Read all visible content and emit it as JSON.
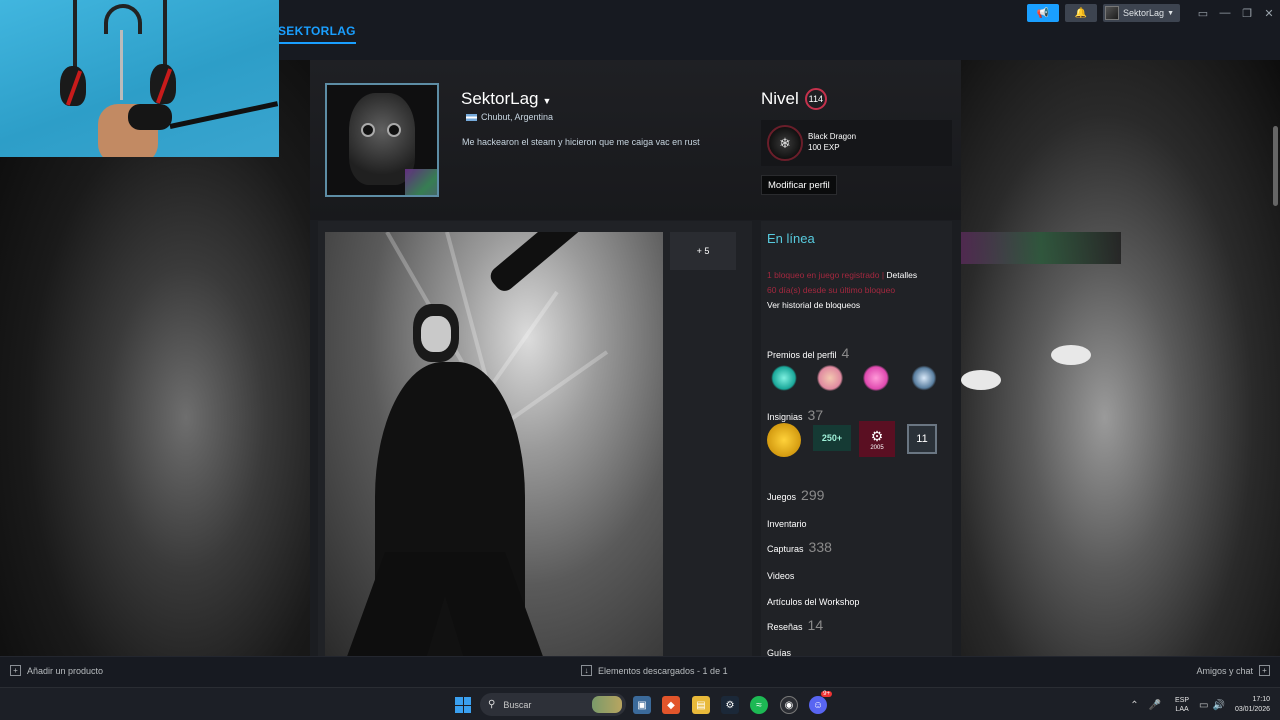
{
  "nav": {
    "active_tab": "SEKTORLAG"
  },
  "topbar": {
    "username": "SektorLag",
    "announce_icon": "megaphone-icon",
    "notification_icon": "bell-icon"
  },
  "profile": {
    "name": "SektorLag",
    "location": "Chubut, Argentina",
    "summary": "Me hackearon el steam y hicieron que me caiga vac en rust",
    "level_label": "Nivel",
    "level": "114",
    "featured_badge": {
      "name": "Black Dragon",
      "xp": "100 EXP"
    },
    "edit_button": "Modificar perfil"
  },
  "showcase": {
    "more_label": "+ 5"
  },
  "sidebar": {
    "status": "En línea",
    "ban_line1": "1 bloqueo en juego registrado",
    "ban_details_sep": " | ",
    "ban_details": "Detalles",
    "ban_line2": "60 día(s) desde su último bloqueo",
    "ban_history": "Ver historial de bloqueos",
    "awards_label": "Premios del perfil",
    "awards_count": "4",
    "badges_label": "Insignias",
    "badges_count": "37",
    "badge_250": "250+",
    "badge_year": "2005",
    "badge_11": "11",
    "games_label": "Juegos",
    "games_count": "299",
    "inventory_label": "Inventario",
    "screenshots_label": "Capturas",
    "screenshots_count": "338",
    "videos_label": "Videos",
    "workshop_label": "Artículos del Workshop",
    "reviews_label": "Reseñas",
    "reviews_count": "14",
    "guides_label": "Guías"
  },
  "steam_bottom": {
    "add_product": "Añadir un producto",
    "downloads": "Elementos descargados - 1 de 1",
    "friends_chat": "Amigos y chat"
  },
  "taskbar": {
    "search_placeholder": "Buscar",
    "lang_line1": "ESP",
    "lang_line2": "LAA",
    "time": "17:10",
    "date": "03/01/2026",
    "discord_badge": "9+"
  },
  "colors": {
    "accent": "#1a9fff",
    "online": "#57cbde",
    "ban_red": "#a3283f",
    "level_ring": "#c5314c"
  }
}
